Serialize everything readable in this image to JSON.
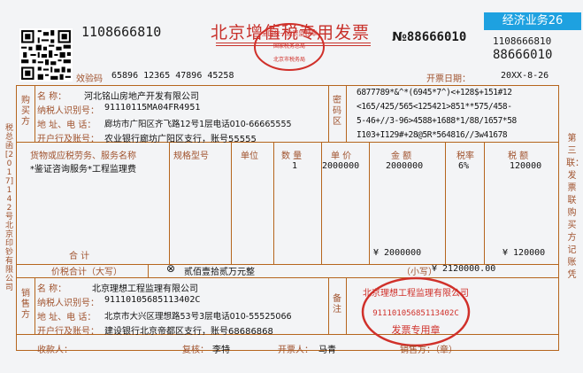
{
  "tag": "经济业务26",
  "header": {
    "code_left": "1108666810",
    "title": "北京增值税专用发票",
    "no_label": "№",
    "no_value": "88666010",
    "right_code": "1108666810",
    "right_no": "88666010",
    "check_label": "效验码",
    "check_code": "65896  12365  47896  45258",
    "date_label": "开票日期：",
    "date_value": "20XX-8-26"
  },
  "seal_top": {
    "line1": "全国统一发票监制章",
    "line2": "国家税务总局",
    "line3": "北京市税务局"
  },
  "left_vertical": "税总函[2017]142号北京印钞有限公司",
  "right_vertical": "第三联：发票联购买方记账凭",
  "buyer": {
    "section": "购买方",
    "name_label": "名      称：",
    "name": "河北铭山房地产开发有限公司",
    "tax_label": "纳税人识别号：",
    "tax": "91110115MA04FR4951",
    "addr_label": "地 址、电 话：",
    "addr": "廊坊市广阳区齐飞路12号1层电话010-66665555",
    "bank_label": "开户行及账号：",
    "bank": "农业银行廊坊广阳区支行，账号55555"
  },
  "cipher": {
    "section": "密码区",
    "lines": [
      "6877789*&^*(6945*7^)<+128$+151#12",
      "<165/425/565<125421>851**575/458-",
      "5-46+//3-96>4588+1688*1/88/1657*58",
      "I103+I129#+28@5R*564816//3w41678"
    ]
  },
  "items_header": {
    "name": "货物或应税劳务、服务名称",
    "spec": "规格型号",
    "unit": "单位",
    "qty": "数 量",
    "price": "单 价",
    "amount": "金  额",
    "rate": "税率",
    "tax": "税  额"
  },
  "items": [
    {
      "name": "*鉴证咨询服务*工程监理费",
      "spec": "",
      "unit": "",
      "qty": "1",
      "price": "2000000",
      "amount": "2000000",
      "rate": "6%",
      "tax": "120000"
    }
  ],
  "subtotal": {
    "label": "合      计",
    "amount": "¥ 2000000",
    "tax": "¥  120000"
  },
  "total": {
    "label": "价税合计（大写）",
    "symbol": "⊗",
    "words": "贰佰壹拾贰万元整",
    "small_label": "（小写）",
    "small_value": "¥ 2120000.00"
  },
  "seller": {
    "section": "销售方",
    "name_label": "名      称：",
    "name": "北京理想工程监理有限公司",
    "tax_label": "纳税人识别号：",
    "tax": "91110105685113402C",
    "addr_label": "地 址、电 话：",
    "addr": "北京市大兴区理想路53号3层电话010-55525066",
    "bank_label": "开户行及账号：",
    "bank": "建设银行北京帝都区支行，账号68686868"
  },
  "remarks": {
    "section": "备注"
  },
  "seal_seller": {
    "company": "北京理想工程监理有限公司",
    "code": "91110105685113402C",
    "footer": "发票专用章"
  },
  "footer": {
    "payee_label": "收款人：",
    "payee": "",
    "reviewer_label": "复核：",
    "reviewer": "李特",
    "drawer_label": "开票人：",
    "drawer": "马青",
    "seller_label": "销售方：（章）"
  },
  "colors": {
    "frame": "#b5651d",
    "seal": "#d0302a",
    "tag": "#1ea1e0"
  }
}
